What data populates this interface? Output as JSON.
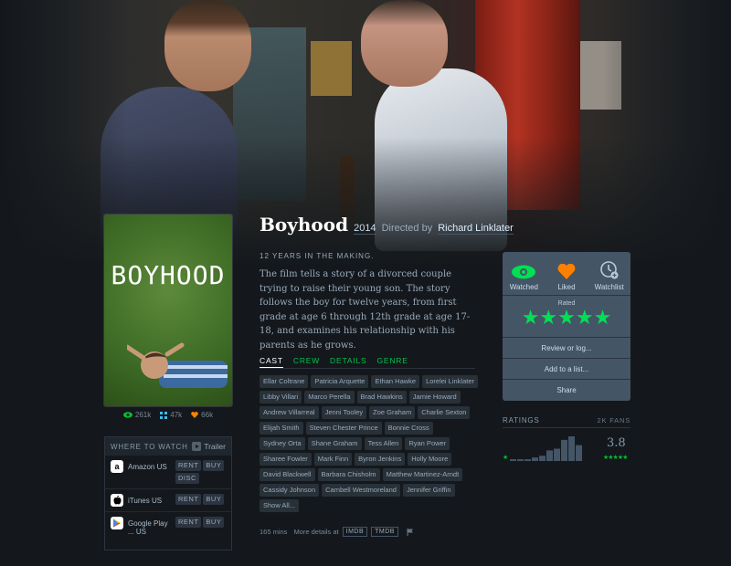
{
  "film": {
    "title": "Boyhood",
    "year": "2014",
    "directed_by": "Directed by",
    "director": "Richard Linklater",
    "tagline": "12 YEARS IN THE MAKING.",
    "synopsis": "The film tells a story of a divorced couple trying to raise their young son. The story follows the boy for twelve years, from first grade at age 6 through 12th grade at age 17-18, and examines his relationship with his parents as he grows.",
    "poster_text": "BOYHOOD"
  },
  "stats": {
    "watched": "261k",
    "lists": "47k",
    "likes": "66k"
  },
  "where_to_watch": {
    "heading": "WHERE TO WATCH",
    "trailer": "Trailer",
    "services": [
      {
        "logo": "amazon-icon",
        "name": "Amazon US",
        "options": [
          "RENT",
          "BUY",
          "DISC"
        ]
      },
      {
        "logo": "apple-icon",
        "name": "iTunes US",
        "options": [
          "RENT",
          "BUY"
        ]
      },
      {
        "logo": "google-play-icon",
        "name": "Google Play ... US",
        "options": [
          "RENT",
          "BUY"
        ]
      }
    ]
  },
  "tabs": [
    "CAST",
    "CREW",
    "DETAILS",
    "GENRE"
  ],
  "cast": [
    "Ellar Coltrane",
    "Patricia Arquette",
    "Ethan Hawke",
    "Lorelei Linklater",
    "Libby Villari",
    "Marco Perella",
    "Brad Hawkins",
    "Jamie Howard",
    "Andrew Villarreal",
    "Jenni Tooley",
    "Zoe Graham",
    "Charlie Sexton",
    "Elijah Smith",
    "Steven Chester Prince",
    "Bonnie Cross",
    "Sydney Orta",
    "Shane Graham",
    "Tess Allen",
    "Ryan Power",
    "Sharee Fowler",
    "Mark Finn",
    "Byron Jenkins",
    "Holly Moore",
    "David Blackwell",
    "Barbara Chisholm",
    "Matthew Martinez-Arndt",
    "Cassidy Johnson",
    "Cambell Westmoreland",
    "Jennifer Griffin",
    "Show All..."
  ],
  "footer": {
    "runtime": "165 mins",
    "more": "More details at",
    "imdb": "IMDB",
    "tmdb": "TMDB"
  },
  "actions": {
    "watched": "Watched",
    "liked": "Liked",
    "watchlist": "Watchlist",
    "rated": "Rated",
    "stars": "★★★★★",
    "rating_value": 5,
    "review": "Review or log...",
    "add_list": "Add to a list...",
    "share": "Share"
  },
  "ratings": {
    "heading": "RATINGS",
    "fans": "2K FANS",
    "average": "3.8",
    "histogram": [
      1,
      1,
      1,
      2,
      3,
      6,
      7,
      12,
      14,
      9
    ]
  },
  "colors": {
    "green": "#00e054",
    "orange": "#ff8000",
    "blue": "#40bcf4"
  }
}
